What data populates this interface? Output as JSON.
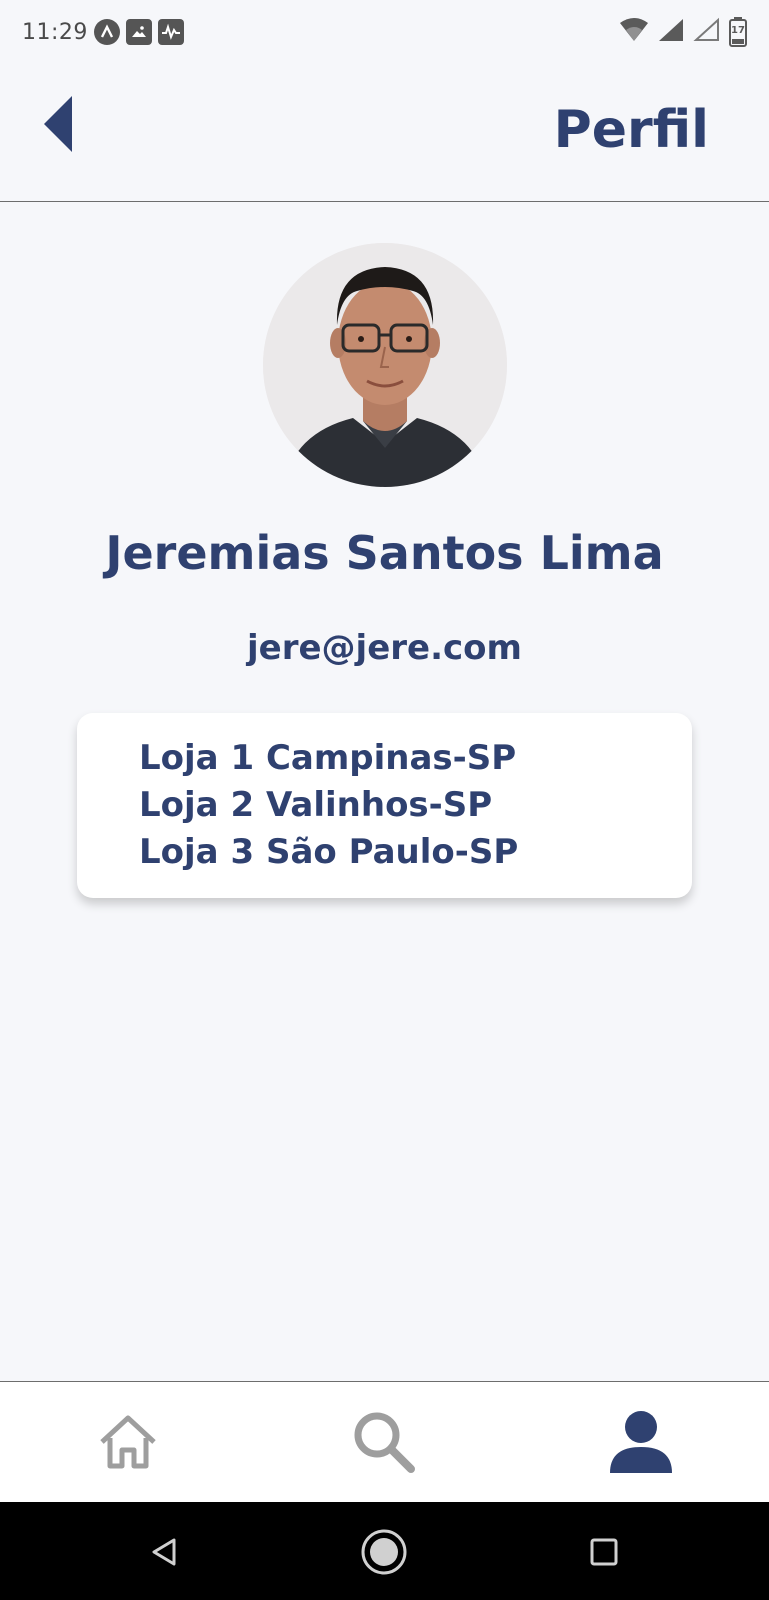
{
  "status_bar": {
    "time": "11:29",
    "battery_level": "17"
  },
  "header": {
    "title": "Perfil"
  },
  "profile": {
    "name": "Jeremias Santos Lima",
    "email": "jere@jere.com",
    "stores": [
      "Loja 1 Campinas-SP",
      "Loja 2 Valinhos-SP",
      "Loja 3 São Paulo-SP"
    ]
  },
  "tab_bar": {
    "tabs": [
      {
        "icon": "home-icon",
        "active": false
      },
      {
        "icon": "search-icon",
        "active": false
      },
      {
        "icon": "user-icon",
        "active": true
      }
    ]
  },
  "colors": {
    "primary": "#2f4170",
    "inactive_icon": "#9e9e9e",
    "background": "#f6f7fa"
  }
}
